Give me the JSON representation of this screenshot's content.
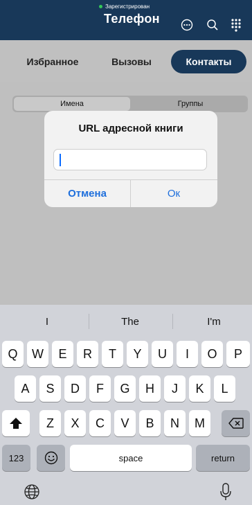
{
  "header": {
    "status": "Зарегистрирован",
    "title": "Телефон",
    "icons": [
      "more-icon",
      "search-icon",
      "grid-icon"
    ]
  },
  "tabs": [
    {
      "label": "Избранное"
    },
    {
      "label": "Вызовы"
    },
    {
      "label": "Контакты",
      "active": true
    }
  ],
  "segmented": {
    "names": "Имена",
    "groups": "Группы"
  },
  "dialog": {
    "title": "URL адресной книги",
    "input_value": "",
    "cancel": "Отмена",
    "ok": "Ок"
  },
  "keyboard": {
    "suggestions": [
      "I",
      "The",
      "I'm"
    ],
    "row1": [
      "Q",
      "W",
      "E",
      "R",
      "T",
      "Y",
      "U",
      "I",
      "O",
      "P"
    ],
    "row2": [
      "A",
      "S",
      "D",
      "F",
      "G",
      "H",
      "J",
      "K",
      "L"
    ],
    "row3": [
      "Z",
      "X",
      "C",
      "V",
      "B",
      "N",
      "M"
    ],
    "numbers": "123",
    "space": "space",
    "return": "return"
  },
  "colors": {
    "brand": "#183859",
    "link": "#1e6fdc",
    "status_dot": "#34c759"
  }
}
